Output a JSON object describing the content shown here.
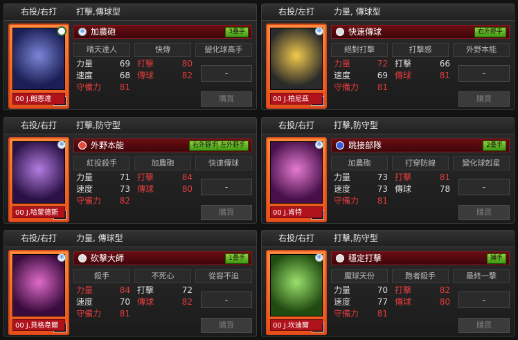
{
  "panels": [
    {
      "hand": "右投/右打",
      "type": "打擊,傳球型",
      "skill": "加農砲",
      "tags": [
        "3壘手"
      ],
      "subs": [
        "晴天達人",
        "快傳",
        "變化球高手"
      ],
      "stats": {
        "power": {
          "label": "力量",
          "value": "69"
        },
        "speed": {
          "label": "速度",
          "value": "68"
        },
        "defense": {
          "label": "守備力",
          "value": "81"
        },
        "hit": {
          "label": "打擊",
          "value": "80"
        },
        "throw": {
          "label": "傳球",
          "value": "82"
        }
      },
      "position": "3B",
      "name": "00 J.朗恩達",
      "slot": "-",
      "buy": "購買"
    },
    {
      "hand": "右投/左打",
      "type": "力量, 傳球型",
      "skill": "快速傳球",
      "tags": [
        "右外野手"
      ],
      "subs": [
        "絕對打擊",
        "打擊感",
        "外野本能"
      ],
      "stats": {
        "power": {
          "label": "力量",
          "value": "72"
        },
        "speed": {
          "label": "速度",
          "value": "69"
        },
        "defense": {
          "label": "守備力",
          "value": "81"
        },
        "hit": {
          "label": "打擊",
          "value": "66"
        },
        "throw": {
          "label": "傳球",
          "value": "81"
        }
      },
      "position": "RF",
      "name": "00 J.柏尼茲",
      "slot": "-",
      "buy": "購買"
    },
    {
      "hand": "右投/右打",
      "type": "打擊,防守型",
      "skill": "外野本能",
      "tags": [
        "右外野手",
        "左外野手"
      ],
      "subs": [
        "紅投殺手",
        "加農砲",
        "快速傳球"
      ],
      "stats": {
        "power": {
          "label": "力量",
          "value": "71"
        },
        "speed": {
          "label": "速度",
          "value": "73"
        },
        "defense": {
          "label": "守備力",
          "value": "82"
        },
        "hit": {
          "label": "打擊",
          "value": "84"
        },
        "throw": {
          "label": "傳球",
          "value": "80"
        }
      },
      "position": "RF",
      "name": "00 J.哈蒙德斯",
      "slot": "-",
      "buy": "購買"
    },
    {
      "hand": "右投/右打",
      "type": "打擊,防守型",
      "skill": "跳接部隊",
      "tags": [
        "2壘手"
      ],
      "subs": [
        "加農砲",
        "打穿防線",
        "變化球剋星"
      ],
      "stats": {
        "power": {
          "label": "力量",
          "value": "73"
        },
        "speed": {
          "label": "速度",
          "value": "73"
        },
        "defense": {
          "label": "守備力",
          "value": "81"
        },
        "hit": {
          "label": "打擊",
          "value": "81"
        },
        "throw": {
          "label": "傳球",
          "value": "78"
        }
      },
      "position": "2B",
      "name": "00 J.肯特",
      "slot": "-",
      "buy": "購買"
    },
    {
      "hand": "右投/右打",
      "type": "力量, 傳球型",
      "skill": "砍擊大師",
      "tags": [
        "1壘手"
      ],
      "subs": [
        "殺手",
        "不死心",
        "從容不迫"
      ],
      "stats": {
        "power": {
          "label": "力量",
          "value": "84"
        },
        "speed": {
          "label": "速度",
          "value": "70"
        },
        "defense": {
          "label": "守備力",
          "value": "81"
        },
        "hit": {
          "label": "打擊",
          "value": "72"
        },
        "throw": {
          "label": "傳球",
          "value": "82"
        }
      },
      "position": "1B",
      "name": "00 J.貝格韋爾",
      "slot": "-",
      "buy": "購買"
    },
    {
      "hand": "右投/右打",
      "type": "打擊,防守型",
      "skill": "穩定打擊",
      "tags": [
        "捕手"
      ],
      "subs": [
        "魔球天份",
        "跑者殺手",
        "最終一擊"
      ],
      "stats": {
        "power": {
          "label": "力量",
          "value": "70"
        },
        "speed": {
          "label": "速度",
          "value": "77"
        },
        "defense": {
          "label": "守備力",
          "value": "81"
        },
        "hit": {
          "label": "打擊",
          "value": "82"
        },
        "throw": {
          "label": "傳球",
          "value": "80"
        }
      },
      "position": "C",
      "name": "00 J.坎迪爾",
      "slot": "-",
      "buy": "購買"
    }
  ],
  "colors": {
    "accent_red": "#e03c3c",
    "card_orange": "#ff8a3a",
    "tag_green": "#6fbf2a"
  }
}
